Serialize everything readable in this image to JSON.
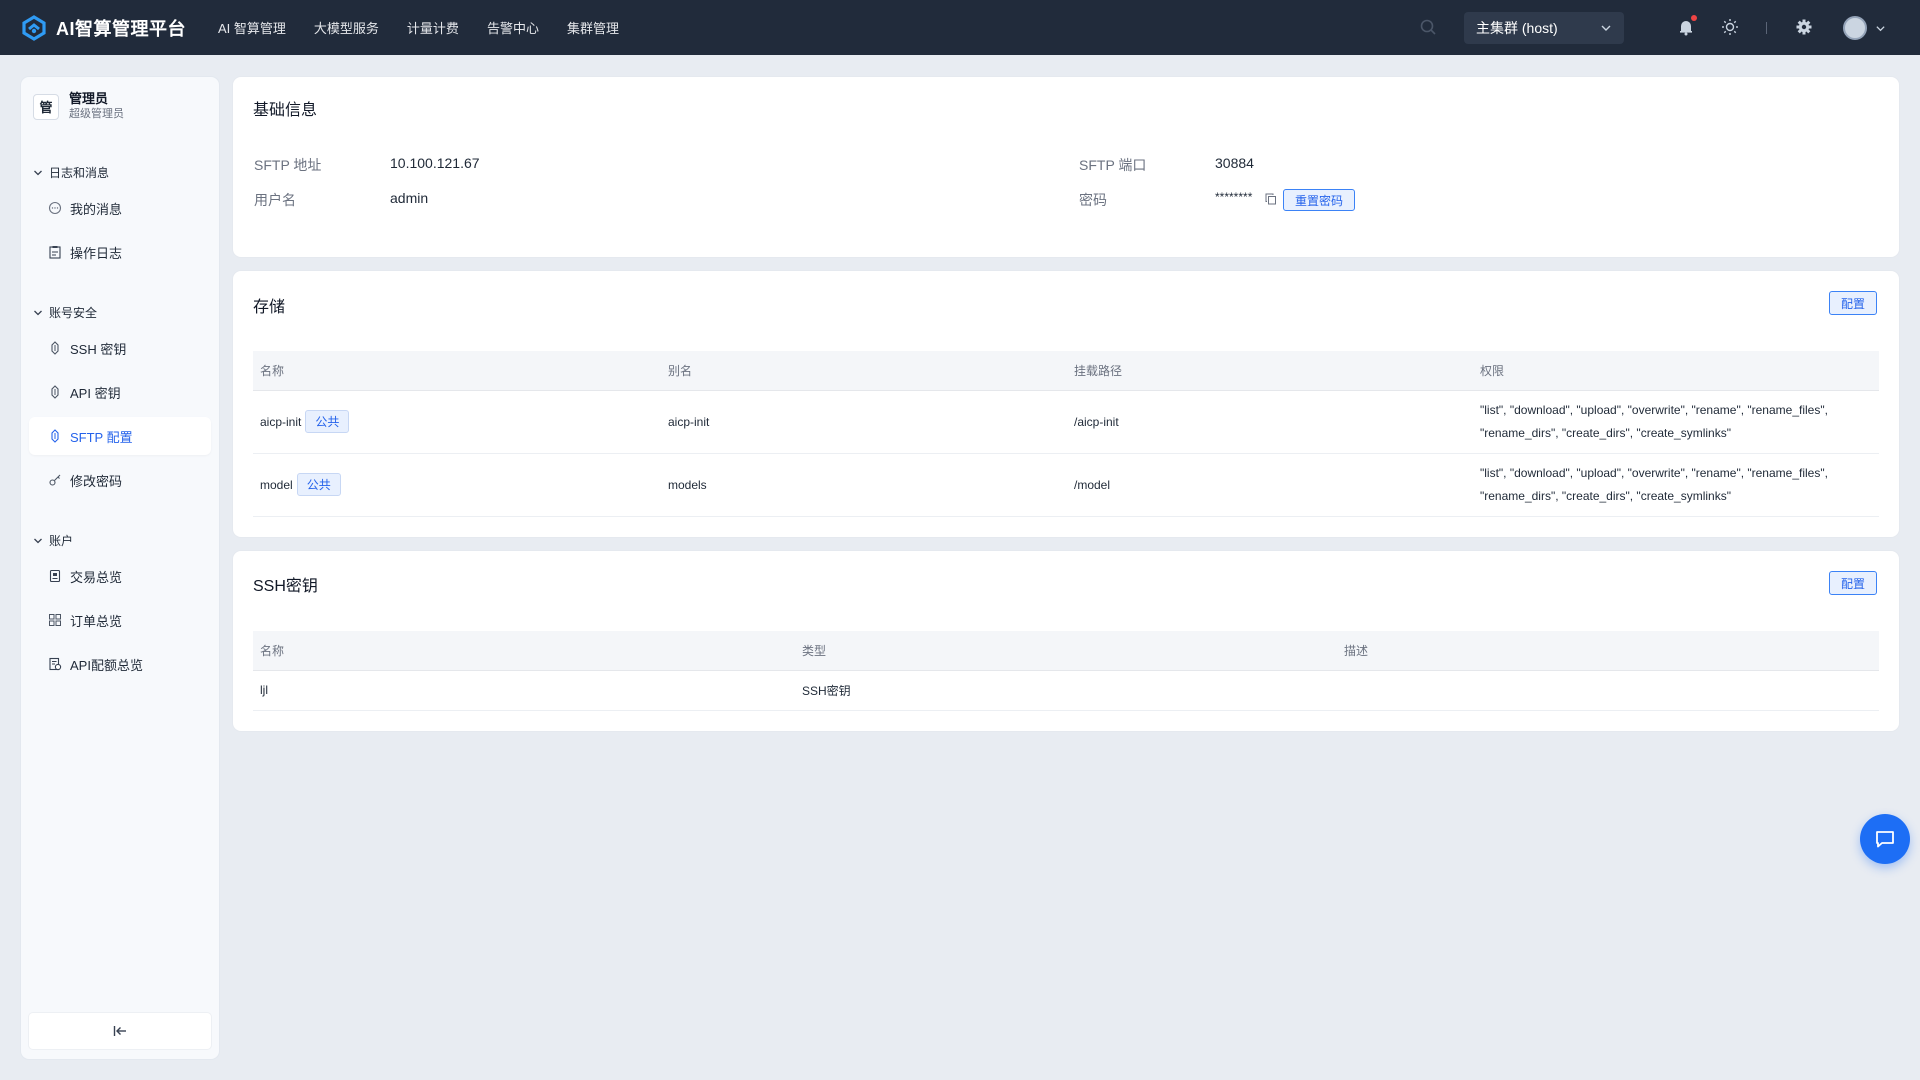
{
  "brand": {
    "name": "AI智算管理平台",
    "accent": "#2f9bf4"
  },
  "topnav": [
    {
      "label": "AI 智算管理"
    },
    {
      "label": "大模型服务"
    },
    {
      "label": "计量计费"
    },
    {
      "label": "告警中心"
    },
    {
      "label": "集群管理"
    }
  ],
  "cluster": {
    "selected": "主集群 (host)"
  },
  "header_icons": [
    "search-icon",
    "bell-icon",
    "sun-icon",
    "settings-icon",
    "avatar"
  ],
  "user": {
    "avatar_char": "管",
    "name": "管理员",
    "role": "超级管理员"
  },
  "sidebar": {
    "groups": [
      {
        "title": "日志和消息",
        "items": [
          {
            "label": "我的消息",
            "icon": "message-icon"
          },
          {
            "label": "操作日志",
            "icon": "log-icon"
          }
        ]
      },
      {
        "title": "账号安全",
        "items": [
          {
            "label": "SSH 密钥",
            "icon": "key-icon"
          },
          {
            "label": "API 密钥",
            "icon": "key-icon"
          },
          {
            "label": "SFTP 配置",
            "icon": "key-icon",
            "active": true
          },
          {
            "label": "修改密码",
            "icon": "password-icon"
          }
        ]
      },
      {
        "title": "账户",
        "items": [
          {
            "label": "交易总览",
            "icon": "transaction-icon"
          },
          {
            "label": "订单总览",
            "icon": "grid-icon"
          },
          {
            "label": "API配额总览",
            "icon": "quota-icon"
          }
        ]
      }
    ],
    "collapse_symbol": "|←"
  },
  "basic_info": {
    "title": "基础信息",
    "sftp_addr_label": "SFTP 地址",
    "sftp_addr": "10.100.121.67",
    "sftp_port_label": "SFTP 端口",
    "sftp_port": "30884",
    "username_label": "用户名",
    "username": "admin",
    "password_label": "密码",
    "password": "********",
    "reset_label": "重置密码"
  },
  "storage": {
    "title": "存储",
    "config_label": "配置",
    "columns": [
      "名称",
      "别名",
      "挂载路径",
      "权限"
    ],
    "rows": [
      {
        "name": "aicp-init",
        "tag": "公共",
        "alias": "aicp-init",
        "path": "/aicp-init",
        "perm_line1": "\"list\", \"download\", \"upload\", \"overwrite\", \"rename\", \"rename_files\",",
        "perm_line2": "\"rename_dirs\", \"create_dirs\", \"create_symlinks\""
      },
      {
        "name": "model",
        "tag": "公共",
        "alias": "models",
        "path": "/model",
        "perm_line1": "\"list\", \"download\", \"upload\", \"overwrite\", \"rename\", \"rename_files\",",
        "perm_line2": "\"rename_dirs\", \"create_dirs\", \"create_symlinks\""
      }
    ]
  },
  "ssh_keys": {
    "title": "SSH密钥",
    "config_label": "配置",
    "columns": [
      "名称",
      "类型",
      "描述"
    ],
    "rows": [
      {
        "name": "ljl",
        "type": "SSH密钥",
        "desc": ""
      }
    ]
  },
  "colors": {
    "topbar": "#212b3b",
    "primary": "#2563eb",
    "fab": "#1d6ef5",
    "page_bg": "#e8ecf2"
  }
}
